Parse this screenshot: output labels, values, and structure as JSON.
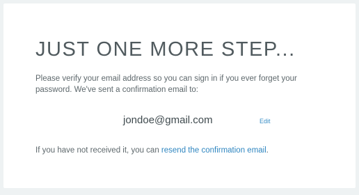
{
  "card": {
    "title": "JUST ONE MORE STEP...",
    "message": "Please verify your email address so you can sign in if you ever forget your password. We've sent a confirmation email to:",
    "email": "jondoe@gmail.com",
    "edit_label": "Edit",
    "footer_prefix": "If you have not received it, you can ",
    "resend_label": "resend the confirmation email",
    "footer_suffix": "."
  },
  "colors": {
    "background": "#eef2f3",
    "card": "#ffffff",
    "title": "#505a5e",
    "body_text": "#5e686c",
    "link": "#2f86c0"
  }
}
